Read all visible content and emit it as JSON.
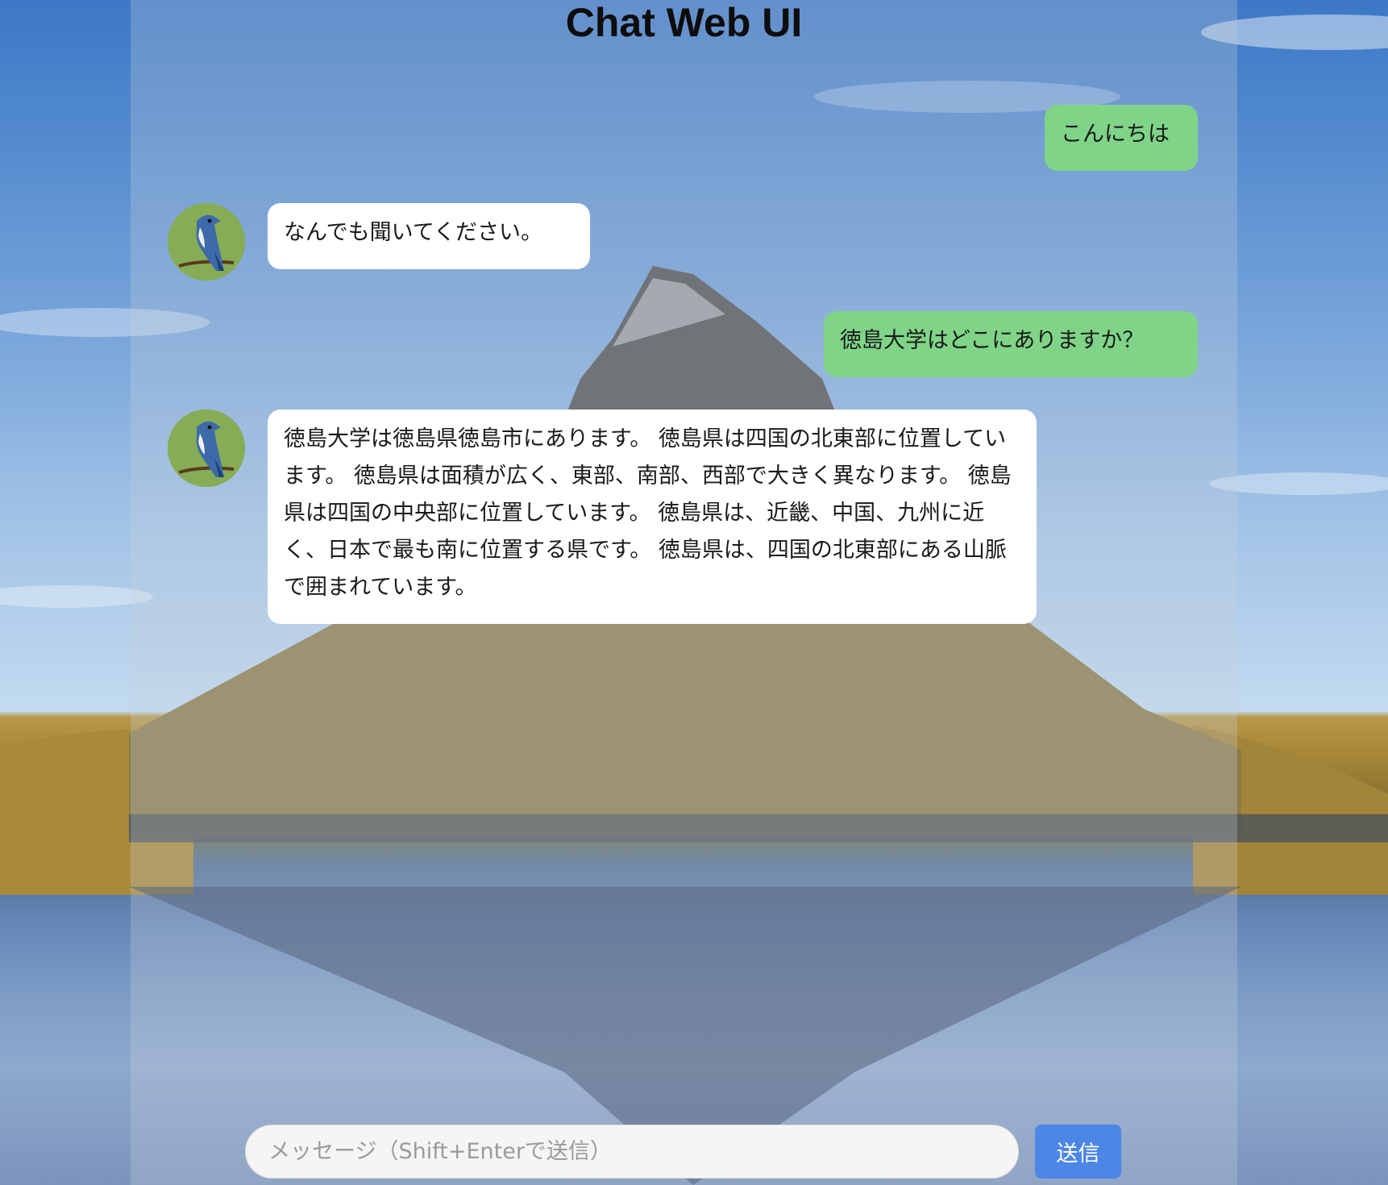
{
  "app": {
    "title": "Chat Web UI"
  },
  "messages": [
    {
      "role": "user",
      "text": "こんにちは"
    },
    {
      "role": "bot",
      "avatar_icon": "blue-jay-avatar-icon",
      "text": "なんでも聞いてください。"
    },
    {
      "role": "user",
      "text": "徳島大学はどこにありますか？"
    },
    {
      "role": "bot",
      "avatar_icon": "blue-jay-avatar-icon",
      "text": "徳島大学は徳島県徳島市にあります。 徳島県は四国の北東部に位置しています。 徳島県は面積が広く、東部、南部、西部で大きく異なります。 徳島県は四国の中央部に位置しています。 徳島県は、近畿、中国、九州に近く、日本で最も南に位置する県です。 徳島県は、四国の北東部にある山脈で囲まれています。"
    }
  ],
  "composer": {
    "placeholder": "メッセージ（Shift+Enterで送信）",
    "value": "",
    "send_label": "送信"
  },
  "colors": {
    "user_bubble": "#7fd487",
    "bot_bubble": "#ffffff",
    "send_button": "#4c86e6"
  }
}
